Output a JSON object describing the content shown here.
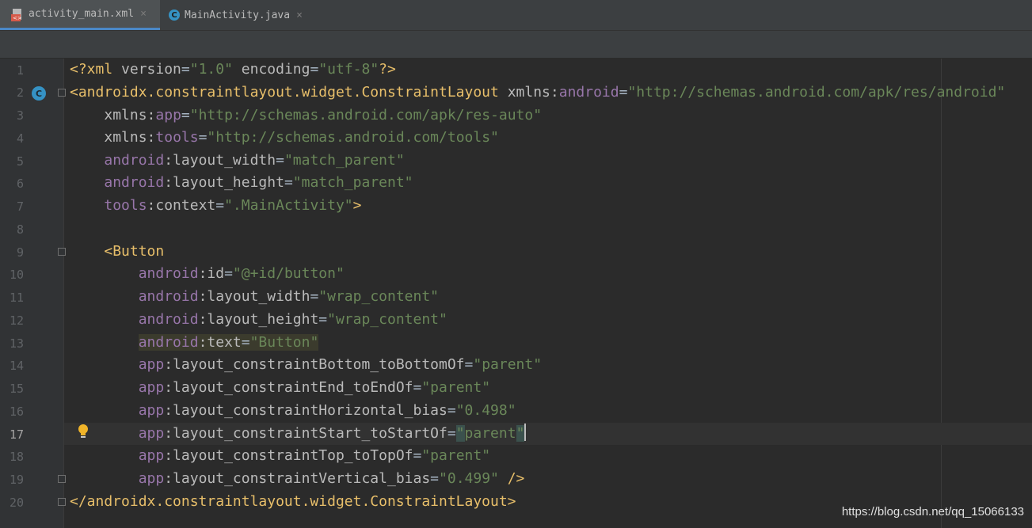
{
  "tabs": [
    {
      "label": "activity_main.xml",
      "icon": "xml-file-icon",
      "active": true
    },
    {
      "label": "MainActivity.java",
      "icon": "java-class-icon",
      "active": false
    }
  ],
  "close_glyph": "×",
  "gutter_class_glyph": "C",
  "line_numbers": [
    "1",
    "2",
    "3",
    "4",
    "5",
    "6",
    "7",
    "8",
    "9",
    "10",
    "11",
    "12",
    "13",
    "14",
    "15",
    "16",
    "17",
    "18",
    "19",
    "20"
  ],
  "current_line": "17",
  "code": {
    "l1": {
      "p1": "<?xml ",
      "a1": "version",
      "e1": "=",
      "v1": "\"1.0\"",
      "sp": " ",
      "a2": "encoding",
      "e2": "=",
      "v2": "\"utf-8\"",
      "end": "?>"
    },
    "l2": {
      "tag": "<androidx.constraintlayout.widget.ConstraintLayout",
      "sp": " ",
      "a1": "xmlns:",
      "ns1": "android",
      "e1": "=",
      "v1": "\"http://schemas.android.com/apk/res/android\""
    },
    "l3": {
      "ind": "    ",
      "a1": "xmlns:",
      "ns1": "app",
      "e1": "=",
      "v1": "\"http://schemas.android.com/apk/res-auto\""
    },
    "l4": {
      "ind": "    ",
      "a1": "xmlns:",
      "ns1": "tools",
      "e1": "=",
      "v1": "\"http://schemas.android.com/tools\""
    },
    "l5": {
      "ind": "    ",
      "ns1": "android",
      "a1": ":layout_width",
      "e1": "=",
      "v1": "\"match_parent\""
    },
    "l6": {
      "ind": "    ",
      "ns1": "android",
      "a1": ":layout_height",
      "e1": "=",
      "v1": "\"match_parent\""
    },
    "l7": {
      "ind": "    ",
      "ns1": "tools",
      "a1": ":context",
      "e1": "=",
      "v1": "\".MainActivity\"",
      "end": ">"
    },
    "l9": {
      "ind": "    ",
      "tag": "<Button"
    },
    "l10": {
      "ind": "        ",
      "ns1": "android",
      "a1": ":id",
      "e1": "=",
      "v1": "\"@+id/button\""
    },
    "l11": {
      "ind": "        ",
      "ns1": "android",
      "a1": ":layout_width",
      "e1": "=",
      "v1": "\"wrap_content\""
    },
    "l12": {
      "ind": "        ",
      "ns1": "android",
      "a1": ":layout_height",
      "e1": "=",
      "v1": "\"wrap_content\""
    },
    "l13": {
      "ind": "        ",
      "ns1": "android",
      "a1": ":text",
      "e1": "=",
      "v1": "\"Button\""
    },
    "l14": {
      "ind": "        ",
      "ns1": "app",
      "a1": ":layout_constraintBottom_toBottomOf",
      "e1": "=",
      "v1": "\"parent\""
    },
    "l15": {
      "ind": "        ",
      "ns1": "app",
      "a1": ":layout_constraintEnd_toEndOf",
      "e1": "=",
      "v1": "\"parent\""
    },
    "l16": {
      "ind": "        ",
      "ns1": "app",
      "a1": ":layout_constraintHorizontal_bias",
      "e1": "=",
      "v1": "\"0.498\""
    },
    "l17": {
      "ind": "        ",
      "ns1": "app",
      "a1": ":layout_constraintStart_toStartOf",
      "e1": "=",
      "q1": "\"",
      "v1": "parent",
      "q2": "\""
    },
    "l18": {
      "ind": "        ",
      "ns1": "app",
      "a1": ":layout_constraintTop_toTopOf",
      "e1": "=",
      "v1": "\"parent\""
    },
    "l19": {
      "ind": "        ",
      "ns1": "app",
      "a1": ":layout_constraintVertical_bias",
      "e1": "=",
      "v1": "\"0.499\"",
      "end": " />"
    },
    "l20": {
      "tag": "</androidx.constraintlayout.widget.ConstraintLayout>"
    }
  },
  "watermark": "https://blog.csdn.net/qq_15066133",
  "colors": {
    "background": "#2b2b2b",
    "gutter": "#313335",
    "tag": "#e8bf6a",
    "attribute": "#bababa",
    "namespace": "#9876aa",
    "string": "#6a8759",
    "line_number": "#606366",
    "active_tab_underline": "#4a88c7"
  }
}
